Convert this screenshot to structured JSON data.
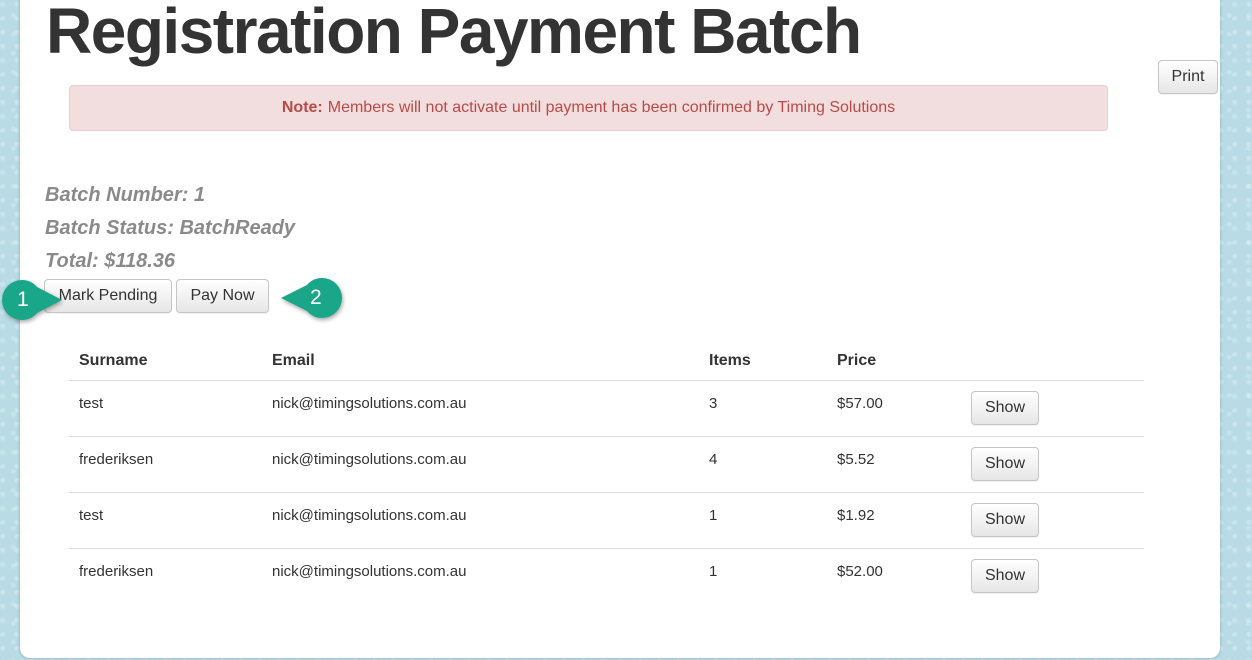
{
  "page": {
    "title": "Registration Payment Batch",
    "print_label": "Print"
  },
  "alert": {
    "label": "Note:",
    "message": "Members will not activate until payment has been confirmed by Timing Solutions"
  },
  "batch": {
    "number_text": "Batch Number: 1",
    "status_text": "Batch Status: BatchReady",
    "total_text": "Total: $118.36"
  },
  "actions": {
    "mark_pending_label": "Mark Pending",
    "pay_now_label": "Pay Now"
  },
  "callouts": {
    "first": "1",
    "second": "2",
    "color": "#1aa689"
  },
  "table": {
    "headers": [
      "Surname",
      "Email",
      "Items",
      "Price",
      ""
    ],
    "rows": [
      {
        "surname": "test",
        "email": "nick@timingsolutions.com.au",
        "items": "3",
        "price": "$57.00",
        "action": "Show"
      },
      {
        "surname": "frederiksen",
        "email": "nick@timingsolutions.com.au",
        "items": "4",
        "price": "$5.52",
        "action": "Show"
      },
      {
        "surname": "test",
        "email": "nick@timingsolutions.com.au",
        "items": "1",
        "price": "$1.92",
        "action": "Show"
      },
      {
        "surname": "frederiksen",
        "email": "nick@timingsolutions.com.au",
        "items": "1",
        "price": "$52.00",
        "action": "Show"
      }
    ]
  }
}
